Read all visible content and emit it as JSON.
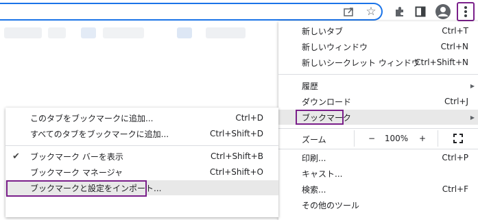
{
  "toolbar": {
    "icons": [
      "share-icon",
      "star-icon",
      "extensions-icon",
      "side-panel-icon",
      "profile-avatar-icon",
      "more-menu-icon"
    ]
  },
  "main_menu": {
    "new_tab": {
      "label": "新しいタブ",
      "shortcut": "Ctrl+T"
    },
    "new_window": {
      "label": "新しいウィンドウ",
      "shortcut": "Ctrl+N"
    },
    "new_incognito": {
      "label": "新しいシークレット ウィンドウ",
      "shortcut": "Ctrl+Shift+N"
    },
    "history": {
      "label": "履歴"
    },
    "downloads": {
      "label": "ダウンロード",
      "shortcut": "Ctrl+J"
    },
    "bookmarks": {
      "label": "ブックマーク"
    },
    "zoom": {
      "label": "ズーム",
      "minus": "−",
      "level": "100%",
      "plus": "+"
    },
    "print": {
      "label": "印刷...",
      "shortcut": "Ctrl+P"
    },
    "cast": {
      "label": "キャスト..."
    },
    "find": {
      "label": "検索...",
      "shortcut": "Ctrl+F"
    },
    "more_tools": {
      "label": "その他のツール"
    }
  },
  "bookmark_submenu": {
    "bookmark_this_tab": {
      "label": "このタブをブックマークに追加...",
      "shortcut": "Ctrl+D"
    },
    "bookmark_all_tabs": {
      "label": "すべてのタブをブックマークに追加...",
      "shortcut": "Ctrl+Shift+D"
    },
    "show_bookmark_bar": {
      "label": "ブックマーク バーを表示",
      "shortcut": "Ctrl+Shift+B",
      "checked": true
    },
    "bookmark_manager": {
      "label": "ブックマーク マネージャ",
      "shortcut": "Ctrl+Shift+O"
    },
    "import": {
      "label": "ブックマークと設定をインポート..."
    }
  },
  "colors": {
    "accent": "#1a73e8",
    "highlight_box": "#7a1f8a",
    "hover": "#e8e8e8"
  }
}
